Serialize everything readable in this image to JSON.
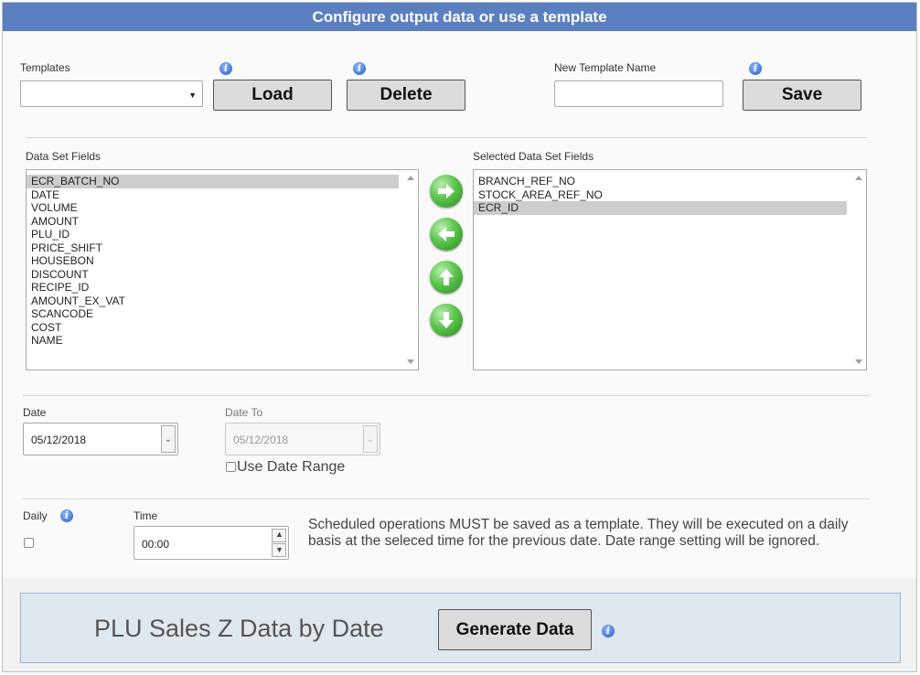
{
  "dialog": {
    "title": "Configure output data or use a template"
  },
  "templates": {
    "label": "Templates",
    "selected_value": "",
    "load_label": "Load",
    "delete_label": "Delete",
    "new_name_label": "New Template Name",
    "new_name_value": "",
    "save_label": "Save"
  },
  "fields": {
    "available_label": "Data Set Fields",
    "available": [
      "ECR_BATCH_NO",
      "DATE",
      "VOLUME",
      "AMOUNT",
      "PLU_ID",
      "PRICE_SHIFT",
      "HOUSEBON",
      "DISCOUNT",
      "RECIPE_ID",
      "AMOUNT_EX_VAT",
      "SCANCODE",
      "COST",
      "NAME"
    ],
    "available_selected": "ECR_BATCH_NO",
    "selected_label": "Selected Data Set Fields",
    "selected": [
      "BRANCH_REF_NO",
      "STOCK_AREA_REF_NO",
      "ECR_ID"
    ],
    "selected_selected": "ECR_ID"
  },
  "dates": {
    "date_label": "Date",
    "date_value": "05/12/2018",
    "date_to_label": "Date To",
    "date_to_value": "05/12/2018",
    "range_label": "Use Date Range"
  },
  "schedule": {
    "daily_label": "Daily",
    "time_label": "Time",
    "time_value": "00:00",
    "note": "Scheduled operations MUST be saved as a template. They will be executed on a daily basis at the seleced time for the previous date. Date range setting will be ignored."
  },
  "footer": {
    "report_title": "PLU Sales Z Data by Date",
    "generate_label": "Generate Data"
  },
  "colors": {
    "title_bar": "#5b80c1",
    "arrow_green": "#3fae32",
    "info_blue": "#1f5fc7"
  }
}
